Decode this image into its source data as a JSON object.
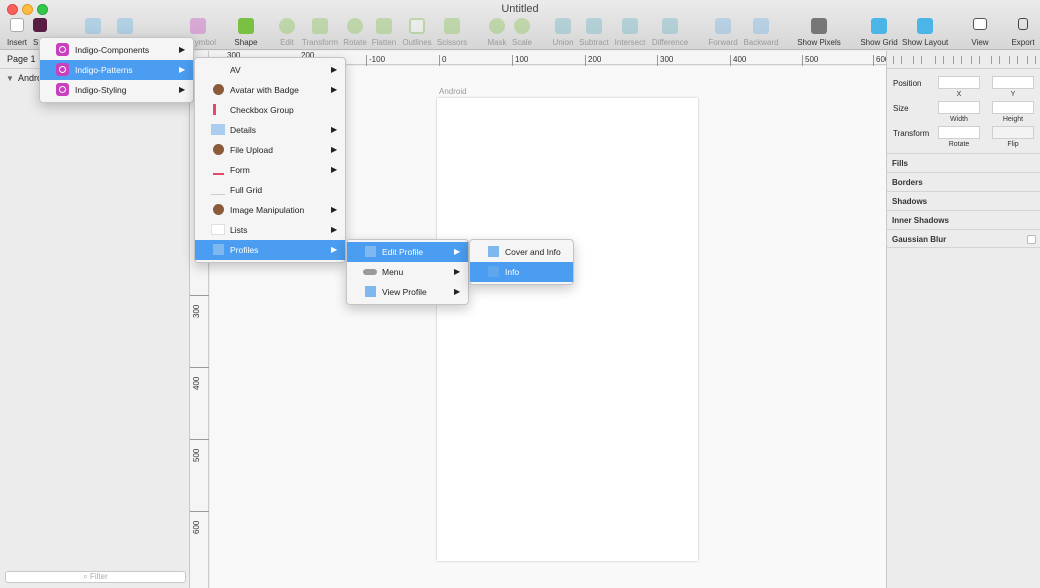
{
  "window": {
    "title": "Untitled"
  },
  "toolbar": {
    "insert": "Insert",
    "symbol_left": "S",
    "symbol_right": "ymbol",
    "shape": "Shape",
    "edit": "Edit",
    "transform": "Transform",
    "rotate": "Rotate",
    "flatten": "Flatten",
    "outlines": "Outlines",
    "scissors": "Scissors",
    "mask": "Mask",
    "scale": "Scale",
    "union": "Union",
    "subtract": "Subtract",
    "intersect": "Intersect",
    "difference": "Difference",
    "forward": "Forward",
    "backward": "Backward",
    "show_pixels": "Show Pixels",
    "show_grid": "Show Grid",
    "show_layout": "Show Layout",
    "view": "View",
    "export": "Export"
  },
  "left_panel": {
    "page": "Page 1",
    "layer": "Androi",
    "filter_placeholder": "Filter"
  },
  "ruler": {
    "h": [
      "300",
      "-100",
      "0",
      "100",
      "200",
      "300",
      "400",
      "500",
      "600"
    ],
    "h_top": [
      "300",
      "200"
    ],
    "v": [
      "300",
      "400",
      "500",
      "600"
    ]
  },
  "canvas": {
    "artboard_label": "Android"
  },
  "inspector": {
    "position": "Position",
    "x": "X",
    "y": "Y",
    "size": "Size",
    "width": "Width",
    "height": "Height",
    "transform": "Transform",
    "rotate": "Rotate",
    "flip": "Flip",
    "fills": "Fills",
    "borders": "Borders",
    "shadows": "Shadows",
    "inner_shadows": "Inner Shadows",
    "gaussian_blur": "Gaussian Blur"
  },
  "menus": {
    "libraries": [
      "Indigo-Components",
      "Indigo-Patterns",
      "Indigo-Styling"
    ],
    "patterns": [
      "AV",
      "Avatar with Badge",
      "Checkbox Group",
      "Details",
      "File Upload",
      "Form",
      "Full Grid",
      "Image Manipulation",
      "Lists",
      "Profiles"
    ],
    "profiles": [
      "Edit Profile",
      "Menu",
      "View Profile"
    ],
    "edit_profile": [
      "Cover and Info",
      "Info"
    ]
  },
  "colors": {
    "accent": "#4a9df0",
    "symbol": "#c83fbf",
    "shape": "#7ac043"
  }
}
